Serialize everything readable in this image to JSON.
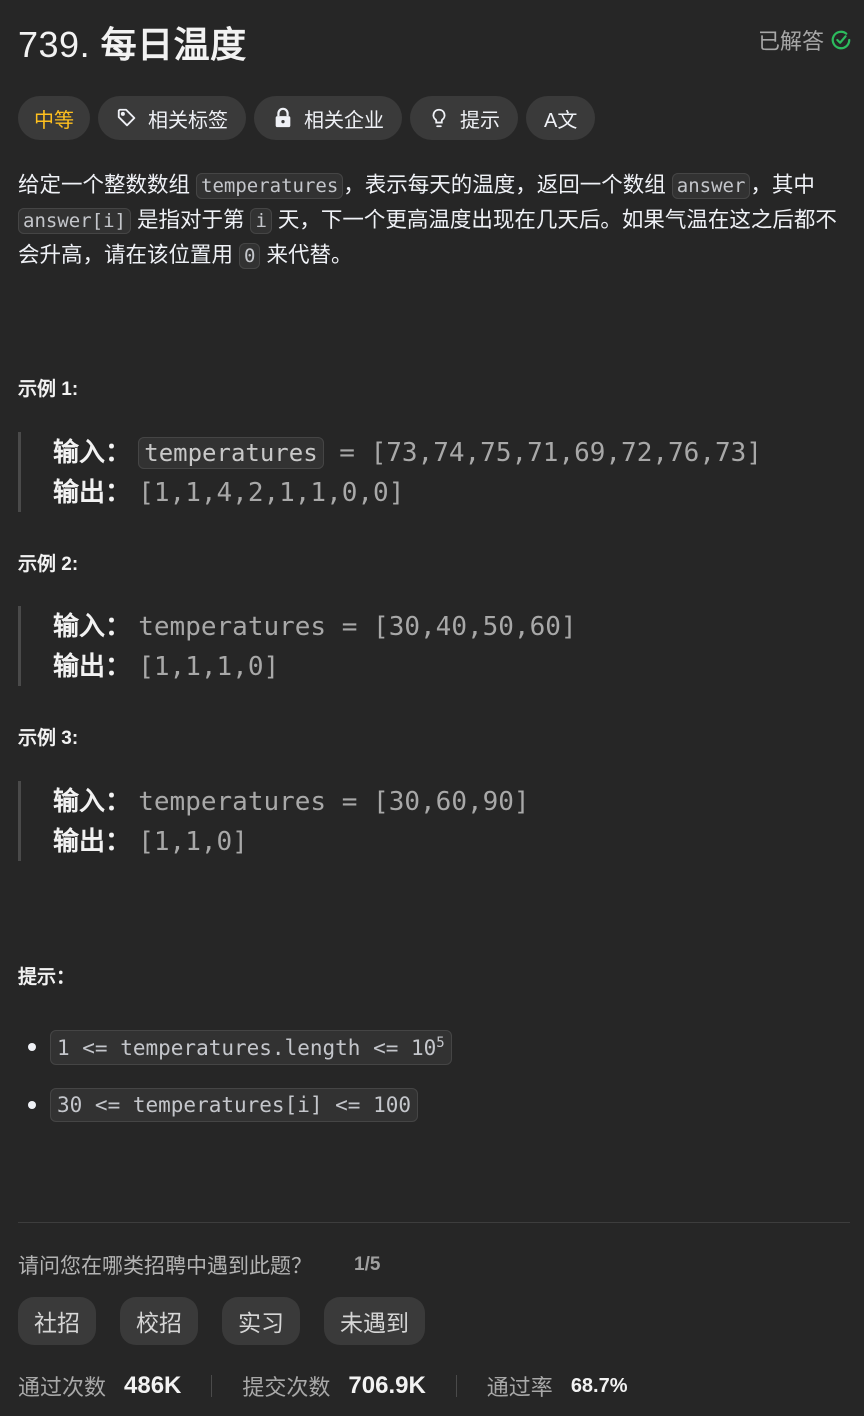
{
  "header": {
    "number": "739.",
    "title": "每日温度",
    "status_label": "已解答",
    "status_color": "#2cbb5d"
  },
  "tags": {
    "difficulty": "中等",
    "difficulty_color": "#ffc01e",
    "related_tags": "相关标签",
    "related_companies": "相关企业",
    "hints": "提示",
    "translate_icon_text": "A文"
  },
  "description": {
    "p1": "给定一个整数数组",
    "code1": "temperatures",
    "p2": "，表示每天的温度，返回一个数组",
    "code2": "answer",
    "p3": "，其中",
    "code3": "answer[i]",
    "p4": "是指对于第",
    "code4": "i",
    "p5": "天，下一个更高温度出现在几天后。如果气温在这之后都不会升高，请在该位置用",
    "code5": "0",
    "p6": "来代替。"
  },
  "examples": [
    {
      "title": "示例 1:",
      "input_label": "输入：",
      "input_var": "temperatures",
      "input_rest": " = [73,74,75,71,69,72,76,73]",
      "output_label": "输出：",
      "output": "[1,1,4,2,1,1,0,0]"
    },
    {
      "title": "示例 2:",
      "input_label": "输入：",
      "input": "temperatures = [30,40,50,60]",
      "output_label": "输出：",
      "output": "[1,1,1,0]"
    },
    {
      "title": "示例 3:",
      "input_label": "输入：",
      "input": "temperatures = [30,60,90]",
      "output_label": "输出：",
      "output": "[1,1,0]"
    }
  ],
  "constraints": {
    "title": "提示：",
    "items": [
      {
        "text": "1 <= temperatures.length <= 10",
        "sup": "5"
      },
      {
        "text": "30 <= temperatures[i] <= 100",
        "sup": ""
      }
    ]
  },
  "survey": {
    "question": "请问您在哪类招聘中遇到此题？",
    "progress": "1/5",
    "options": [
      "社招",
      "校招",
      "实习",
      "未遇到"
    ]
  },
  "stats": {
    "accepted_label": "通过次数",
    "accepted_value": "486K",
    "submissions_label": "提交次数",
    "submissions_value": "706.9K",
    "rate_label": "通过率",
    "rate_value": "68.7%"
  }
}
